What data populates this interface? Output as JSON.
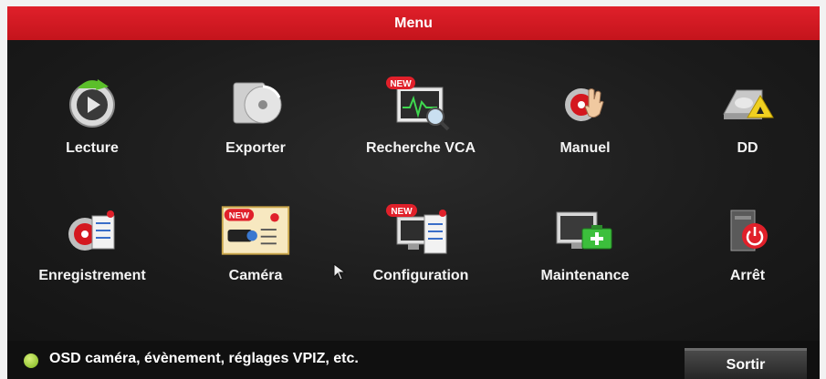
{
  "title": "Menu",
  "colors": {
    "accent": "#d0171f",
    "status_dot": "#9ccc2c"
  },
  "row1": [
    {
      "label": "Lecture",
      "icon": "playback-icon"
    },
    {
      "label": "Exporter",
      "icon": "export-disc-icon"
    },
    {
      "label": "Recherche VCA",
      "icon": "vca-search-icon",
      "badge": "NEW"
    },
    {
      "label": "Manuel",
      "icon": "manual-record-icon"
    },
    {
      "label": "DD",
      "icon": "hard-disk-warning-icon"
    }
  ],
  "row2": [
    {
      "label": "Enregistrement",
      "icon": "record-schedule-icon"
    },
    {
      "label": "Caméra",
      "icon": "camera-settings-icon",
      "badge": "NEW"
    },
    {
      "label": "Configuration",
      "icon": "configuration-icon",
      "badge": "NEW"
    },
    {
      "label": "Maintenance",
      "icon": "maintenance-icon"
    },
    {
      "label": "Arrêt",
      "icon": "power-off-icon"
    }
  ],
  "status": {
    "text": "OSD caméra, évènement, réglages VPIZ, etc."
  },
  "exit_button": {
    "label": "Sortir"
  }
}
